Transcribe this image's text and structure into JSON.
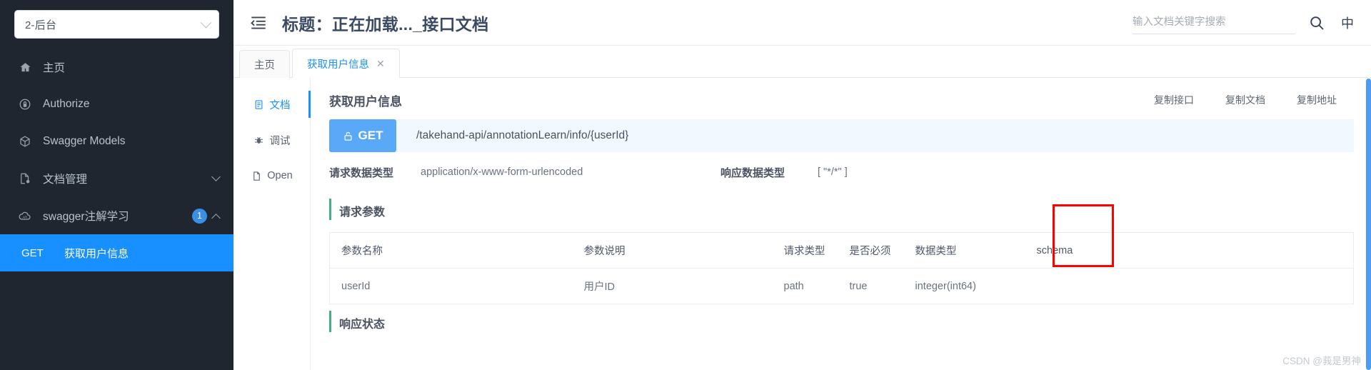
{
  "sidebar": {
    "project_select": {
      "value": "2-后台",
      "icon": "chevron-down-icon"
    },
    "items": [
      {
        "id": "home",
        "label": "主页",
        "icon": "home-icon"
      },
      {
        "id": "authorize",
        "label": "Authorize",
        "icon": "lock-icon"
      },
      {
        "id": "models",
        "label": "Swagger Models",
        "icon": "cube-icon"
      },
      {
        "id": "docs",
        "label": "文档管理",
        "icon": "document-settings-icon",
        "chevron": "chevron-down-icon"
      },
      {
        "id": "group",
        "label": "swagger注解学习",
        "icon": "api-cloud-icon",
        "badge": "1",
        "chevron": "chevron-up-icon",
        "expanded": true
      }
    ],
    "api_item": {
      "method": "GET",
      "label": "获取用户信息",
      "active": true
    }
  },
  "topbar": {
    "fold_icon": "menu-fold-icon",
    "title": "标题：正在加载..._接口文档",
    "search": {
      "placeholder": "输入文档关键字搜索",
      "value": "",
      "icon": "search-icon"
    },
    "lang_toggle": "中"
  },
  "tabs": [
    {
      "id": "home",
      "label": "主页",
      "active": false,
      "closable": false
    },
    {
      "id": "getuser",
      "label": "获取用户信息",
      "active": true,
      "closable": true,
      "close_label": "✕"
    }
  ],
  "vertical_tabs": [
    {
      "id": "doc",
      "label": "文档",
      "icon": "document-icon",
      "active": true
    },
    {
      "id": "debug",
      "label": "调试",
      "icon": "bug-icon",
      "active": false
    },
    {
      "id": "open",
      "label": "Open",
      "icon": "file-icon",
      "active": false
    }
  ],
  "doc": {
    "title": "获取用户信息",
    "actions": [
      "复制接口",
      "复制文档",
      "复制地址"
    ],
    "method": "GET",
    "method_color": "#5aa9f8",
    "lock_icon": "unlock-icon",
    "url": "/takehand-api/annotationLearn/info/{userId}",
    "request_type_label": "请求数据类型",
    "request_type_value": "application/x-www-form-urlencoded",
    "response_type_label": "响应数据类型",
    "response_type_value": "[ \"*/*\" ]",
    "params_section_title": "请求参数",
    "params_table": {
      "headers": [
        "参数名称",
        "参数说明",
        "请求类型",
        "是否必须",
        "数据类型",
        "schema"
      ],
      "rows": [
        {
          "name": "userId",
          "description": "用户ID",
          "request_type": "path",
          "required": "true",
          "data_type": "integer(int64)",
          "schema": ""
        }
      ]
    },
    "status_section_title": "响应状态"
  },
  "annotation": {
    "highlight_color": "#ff0000",
    "highlight_target": "是否必须"
  },
  "watermark": "CSDN @莪是男神"
}
